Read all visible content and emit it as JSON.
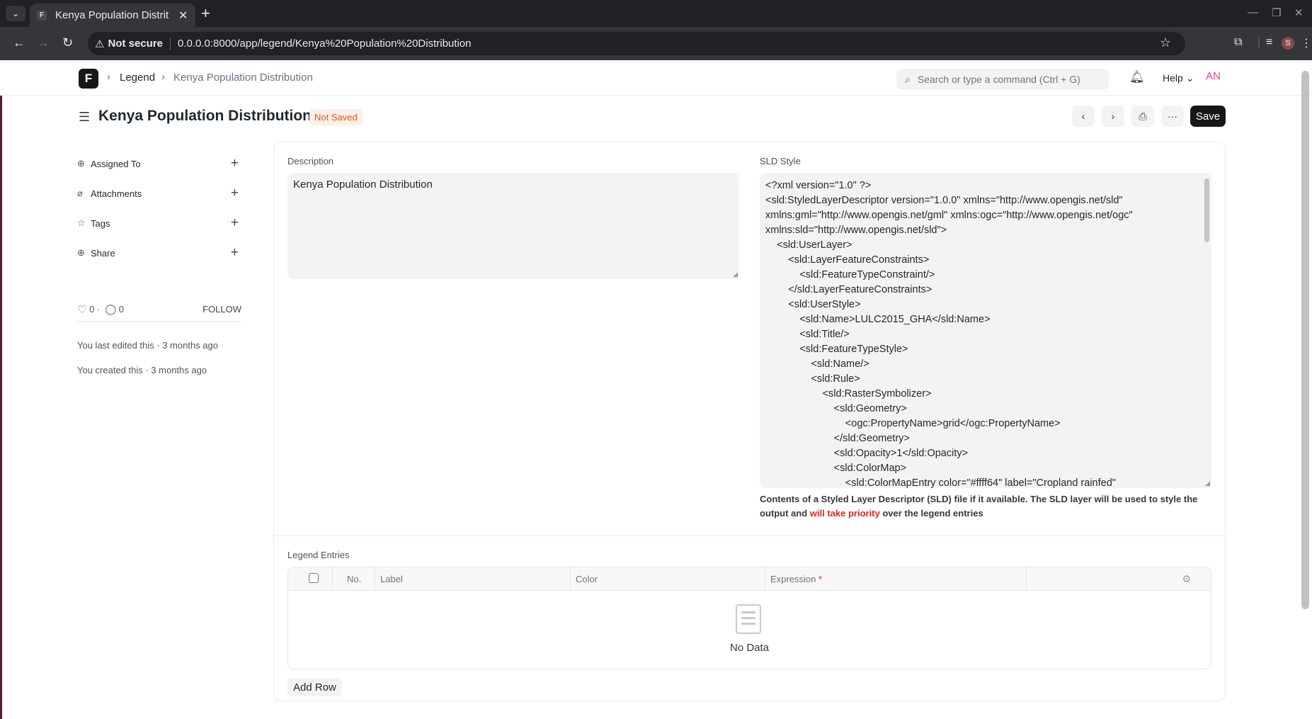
{
  "browser": {
    "tab_title": "Kenya Population Distrit",
    "not_secure": "Not secure",
    "url": "0.0.0.0:8000/app/legend/Kenya%20Population%20Distribution",
    "profile_initial": "S"
  },
  "navbar": {
    "logo_letter": "F",
    "breadcrumb": [
      "Legend",
      "Kenya Population Distribution"
    ],
    "search_placeholder": "Search or type a command (Ctrl + G)",
    "help_label": "Help",
    "avatar_initials": "AN"
  },
  "header": {
    "title": "Kenya Population Distribution",
    "status": "Not Saved",
    "save_label": "Save"
  },
  "sidebar": {
    "items": [
      {
        "label": "Assigned To",
        "icon": "user-assign-icon"
      },
      {
        "label": "Attachments",
        "icon": "paperclip-icon"
      },
      {
        "label": "Tags",
        "icon": "tag-icon"
      },
      {
        "label": "Share",
        "icon": "share-icon"
      }
    ],
    "likes": "0",
    "comments": "0",
    "follow_label": "FOLLOW",
    "last_edited": "You last edited this · 3 months ago",
    "created": "You created this · 3 months ago"
  },
  "form": {
    "description_label": "Description",
    "description_value": "Kenya Population Distribution",
    "sld_label": "SLD Style",
    "sld_lines": [
      "<?xml version=\"1.0\" ?>",
      "<sld:StyledLayerDescriptor version=\"1.0.0\" xmlns=\"http://www.opengis.net/sld\"",
      "xmlns:gml=\"http://www.opengis.net/gml\" xmlns:ogc=\"http://www.opengis.net/ogc\"",
      "xmlns:sld=\"http://www.opengis.net/sld\">",
      "    <sld:UserLayer>",
      "        <sld:LayerFeatureConstraints>",
      "            <sld:FeatureTypeConstraint/>",
      "        </sld:LayerFeatureConstraints>",
      "        <sld:UserStyle>",
      "            <sld:Name>LULC2015_GHA</sld:Name>",
      "            <sld:Title/>",
      "            <sld:FeatureTypeStyle>",
      "                <sld:Name/>",
      "                <sld:Rule>",
      "                    <sld:RasterSymbolizer>",
      "                        <sld:Geometry>",
      "                            <ogc:PropertyName>grid</ogc:PropertyName>",
      "                        </sld:Geometry>",
      "                        <sld:Opacity>1</sld:Opacity>",
      "                        <sld:ColorMap>",
      "                            <sld:ColorMapEntry color=\"#ffff64\" label=\"Cropland rainfed\""
    ],
    "sld_help_pre": "Contents of a Styled Layer Descriptor (SLD) file if it available. The SLD layer will be used to style the output and ",
    "sld_help_highlight": "will take priority",
    "sld_help_post": " over the legend entries",
    "legend_label": "Legend Entries",
    "table_headers": {
      "no": "No.",
      "label": "Label",
      "color": "Color",
      "expression": "Expression",
      "required_mark": "*"
    },
    "no_data": "No Data",
    "add_row": "Add Row"
  }
}
